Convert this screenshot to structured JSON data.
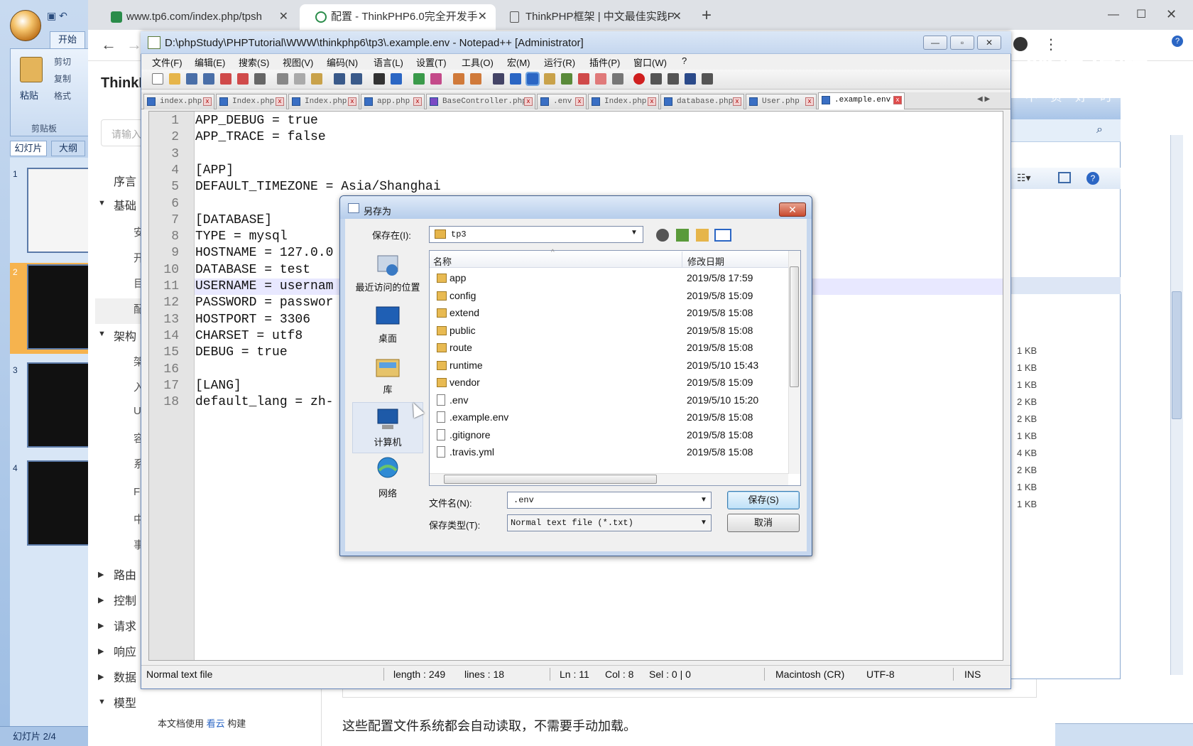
{
  "browser": {
    "tabs": [
      {
        "title": "www.tp6.com/index.php/tpsh",
        "close": "✕"
      },
      {
        "title": "配置 - ThinkPHP6.0完全开发手",
        "close": "✕"
      },
      {
        "title": "ThinkPHP框架 | 中文最佳实践P",
        "close": "✕"
      }
    ],
    "new_tab": "+",
    "site_brand": "ThinkP",
    "search_placeholder": "请输入",
    "nav": [
      {
        "label": "序言"
      },
      {
        "label": "基础"
      },
      {
        "label": "架构"
      },
      {
        "label": "路由"
      },
      {
        "label": "控制"
      },
      {
        "label": "请求"
      },
      {
        "label": "响应"
      },
      {
        "label": "数据"
      },
      {
        "label": "模型"
      }
    ],
    "nav_subs": [
      "安",
      "开",
      "目",
      "配",
      "架",
      "入",
      "U",
      "容",
      "系",
      "F",
      "中",
      "事"
    ],
    "footer_prefix": "本文档使用",
    "footer_link": "看云",
    "footer_suffix": "构建",
    "content_text": "这些配置文件系统都会自动读取，不需要手动加载。"
  },
  "ppt": {
    "tab_home": "开始",
    "paste": "粘贴",
    "cut": "剪切",
    "copy": "复制",
    "format": "格式",
    "clipboard": "剪贴板",
    "slides_tab": "幻灯片",
    "outline_tab": "大纲",
    "slide_numbers": [
      "1",
      "2",
      "3",
      "4"
    ],
    "status": "幻灯片 2/4"
  },
  "explorer": {
    "kb_values": [
      "1 KB",
      "1 KB",
      "1 KB",
      "2 KB",
      "2 KB",
      "1 KB",
      "4 KB",
      "2 KB",
      "1 KB",
      "1 KB"
    ]
  },
  "watermark": {
    "text": "腾讯视频",
    "slogan": "不负好时光"
  },
  "npp": {
    "title": "D:\\phpStudy\\PHPTutorial\\WWW\\thinkphp6\\tp3\\.example.env - Notepad++ [Administrator]",
    "menu": [
      "文件(F)",
      "编辑(E)",
      "搜索(S)",
      "视图(V)",
      "编码(N)",
      "语言(L)",
      "设置(T)",
      "工具(O)",
      "宏(M)",
      "运行(R)",
      "插件(P)",
      "窗口(W)",
      "?"
    ],
    "tabs": [
      "index.php",
      "Index.php",
      "Index.php",
      "app.php",
      "BaseController.php",
      ".env",
      "Index.php",
      "database.php",
      "User.php",
      ".example.env"
    ],
    "active_tab": 9,
    "lines": [
      "APP_DEBUG = true",
      "APP_TRACE = false",
      "",
      "[APP]",
      "DEFAULT_TIMEZONE = Asia/Shanghai",
      "",
      "[DATABASE]",
      "TYPE = mysql",
      "HOSTNAME = 127.0.0",
      "DATABASE = test",
      "USERNAME = usernam",
      "PASSWORD = passwor",
      "HOSTPORT = 3306",
      "CHARSET = utf8",
      "DEBUG = true",
      "",
      "[LANG]",
      "default_lang = zh-"
    ],
    "current_line": 11,
    "status": {
      "type": "Normal text file",
      "length": "length : 249",
      "lines": "lines : 18",
      "ln": "Ln : 11",
      "col": "Col : 8",
      "sel": "Sel : 0 | 0",
      "eol": "Macintosh (CR)",
      "encoding": "UTF-8",
      "mode": "INS"
    }
  },
  "dialog": {
    "title": "另存为",
    "close": "✕",
    "save_in_label": "保存在(I):",
    "save_in_value": "tp3",
    "places": [
      "最近访问的位置",
      "桌面",
      "库",
      "计算机",
      "网络"
    ],
    "col_name": "名称",
    "col_date": "修改日期",
    "files": [
      {
        "name": "app",
        "date": "2019/5/8 17:59",
        "type": "folder"
      },
      {
        "name": "config",
        "date": "2019/5/8 15:09",
        "type": "folder"
      },
      {
        "name": "extend",
        "date": "2019/5/8 15:08",
        "type": "folder"
      },
      {
        "name": "public",
        "date": "2019/5/8 15:08",
        "type": "folder"
      },
      {
        "name": "route",
        "date": "2019/5/8 15:08",
        "type": "folder"
      },
      {
        "name": "runtime",
        "date": "2019/5/10 15:43",
        "type": "folder"
      },
      {
        "name": "vendor",
        "date": "2019/5/8 15:09",
        "type": "folder"
      },
      {
        "name": ".env",
        "date": "2019/5/10 15:20",
        "type": "file"
      },
      {
        "name": ".example.env",
        "date": "2019/5/8 15:08",
        "type": "file"
      },
      {
        "name": ".gitignore",
        "date": "2019/5/8 15:08",
        "type": "file"
      },
      {
        "name": ".travis.yml",
        "date": "2019/5/8 15:08",
        "type": "file"
      }
    ],
    "filename_label": "文件名(N):",
    "filename_value": ".env",
    "filetype_label": "保存类型(T):",
    "filetype_value": "Normal text file (*.txt)",
    "save_button": "保存(S)",
    "cancel_button": "取消"
  }
}
